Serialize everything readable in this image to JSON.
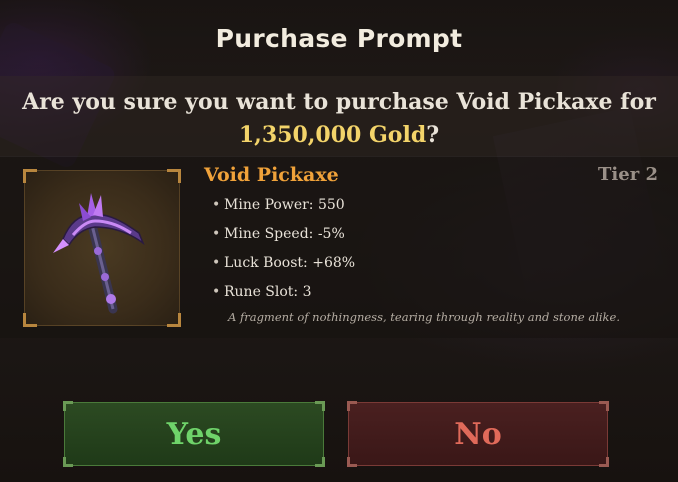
{
  "dialog": {
    "title": "Purchase Prompt",
    "question_prefix": "Are you sure you want to purchase Void Pickaxe for",
    "price": "1,350,000 Gold",
    "question_suffix": "?"
  },
  "item": {
    "name": "Void Pickaxe",
    "tier": "Tier 2",
    "icon": "void-pickaxe-icon",
    "stats": [
      {
        "label": "Mine Power:",
        "value": "550"
      },
      {
        "label": "Mine Speed:",
        "value": "-5%"
      },
      {
        "label": "Luck Boost:",
        "value": "+68%"
      },
      {
        "label": "Rune Slot:",
        "value": "3"
      }
    ],
    "description": "A fragment of nothingness, tearing through reality and stone alike."
  },
  "buttons": {
    "yes_label": "Yes",
    "no_label": "No"
  },
  "colors": {
    "item_name": "#f0a23a",
    "price": "#f3d46a",
    "yes": "#6fd36a",
    "no": "#e06a5a"
  }
}
